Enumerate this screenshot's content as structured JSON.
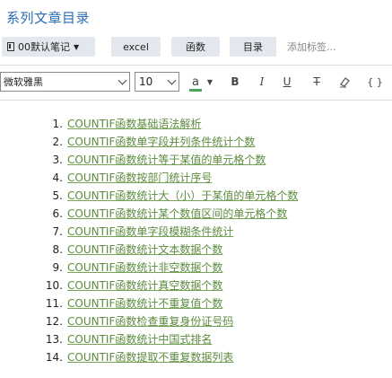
{
  "title": "系列文章目录",
  "tagbar": {
    "notebook": "00默认笔记",
    "tags": [
      "excel",
      "函数",
      "目录"
    ],
    "add_tag": "添加标签..."
  },
  "toolbar": {
    "font": "微软雅黑",
    "size": "10",
    "font_color_letter": "a",
    "bold": "B",
    "italic": "I",
    "underline": "U",
    "strike": "T",
    "code": "{ }",
    "accent": "#4aa35a"
  },
  "toc": [
    {
      "num": "1.",
      "text": "COUNTIF函数基础语法解析"
    },
    {
      "num": "2.",
      "text": "COUNTIF函数单字段并列条件统计个数"
    },
    {
      "num": "3.",
      "text": "COUNTIF函数统计等于某值的单元格个数"
    },
    {
      "num": "4.",
      "text": "COUNTIF函数按部门统计序号"
    },
    {
      "num": "5.",
      "text": "COUNTIF函数统计大（小）于某值的单元格个数"
    },
    {
      "num": "6.",
      "text": "COUNTIF函数统计某个数值区间的单元格个数"
    },
    {
      "num": "7.",
      "text": "COUNTIF函数单字段模糊条件统计"
    },
    {
      "num": "8.",
      "text": "COUNTIF函数统计文本数据个数"
    },
    {
      "num": "9.",
      "text": "COUNTIF函数统计非空数据个数"
    },
    {
      "num": "10.",
      "text": "COUNTIF函数统计真空数据个数"
    },
    {
      "num": "11.",
      "text": "COUNTIF函数统计不重复值个数"
    },
    {
      "num": "12.",
      "text": "COUNTIF函数检查重复身份证号码"
    },
    {
      "num": "13.",
      "text": "COUNTIF函数统计中国式排名"
    },
    {
      "num": "14.",
      "text": "COUNTIF函数提取不重复数据列表"
    }
  ]
}
